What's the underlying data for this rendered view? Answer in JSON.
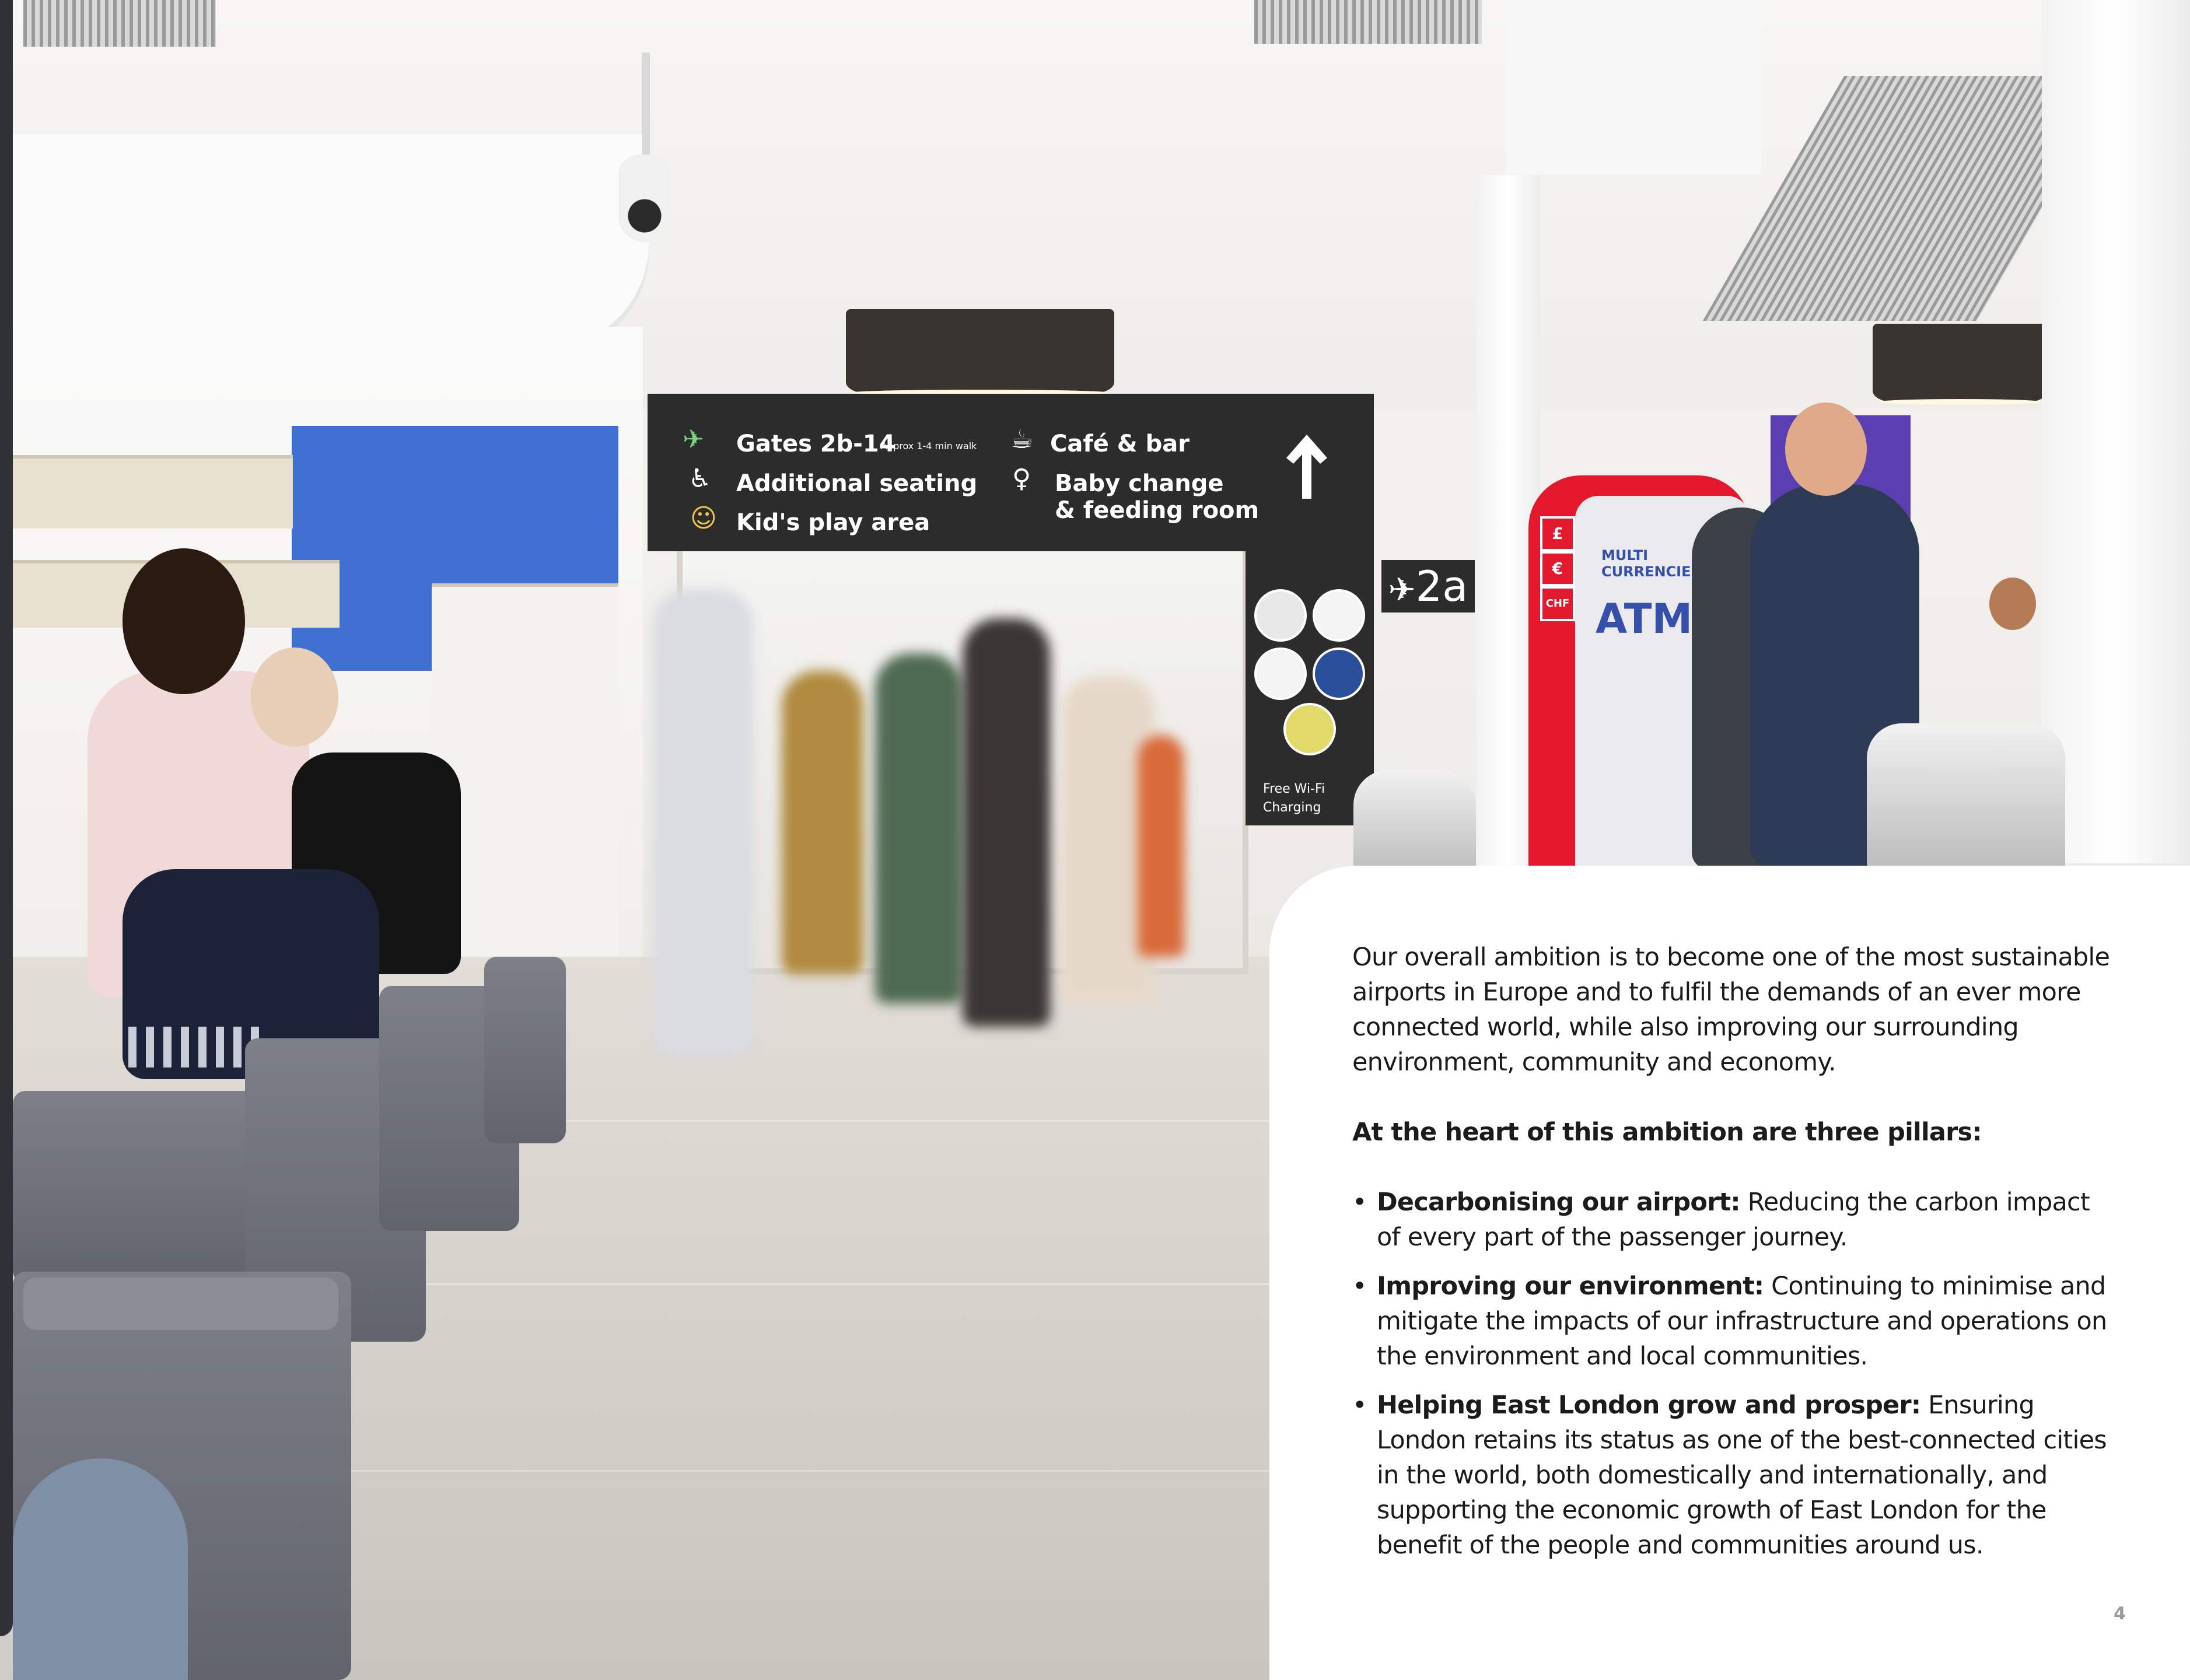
{
  "photo": {
    "signage": {
      "gates": "Gates 2b-14",
      "gates_walk": "Approx 1-4 min walk",
      "seating": "Additional seating",
      "play_area": "Kid's play area",
      "cafe": "Café & bar",
      "baby_change_1": "Baby change",
      "baby_change_2": "& feeding room",
      "wifi": "Free Wi-Fi",
      "charging": "Charging",
      "gate_badge": "2a"
    },
    "atm": {
      "multi_1": "MULTI",
      "multi_2": "CURRENCIES",
      "label": "ATM",
      "currencies": [
        "£",
        "€",
        "CHF"
      ]
    },
    "colors": {
      "sign": "#2c2c2c",
      "atm_red": "#e3182d",
      "shop_blue": "#3f6fd0",
      "ottoman": "#6b6e76"
    }
  },
  "content": {
    "intro": "Our overall ambition is to become one of the most sustainable airports in Europe and to fulfil the demands of an ever more connected world, while also improving our surrounding environment, community and economy.",
    "pillars_heading": "At the heart of this ambition are three pillars:",
    "pillars": [
      {
        "title": "Decarbonising our airport:",
        "text": " Reducing the carbon impact of every part of the passenger journey."
      },
      {
        "title": "Improving our environment:",
        "text": " Continuing to minimise and mitigate the impacts of our infrastructure and operations on the environment and local communities."
      },
      {
        "title": "Helping East London grow and prosper:",
        "text": " Ensuring London retains its status as one of the best-connected cities in the world, both domestically and internationally, and supporting the economic growth of East London for the benefit of the people and communities around us."
      }
    ],
    "bullet": "•",
    "page_number": "4"
  }
}
